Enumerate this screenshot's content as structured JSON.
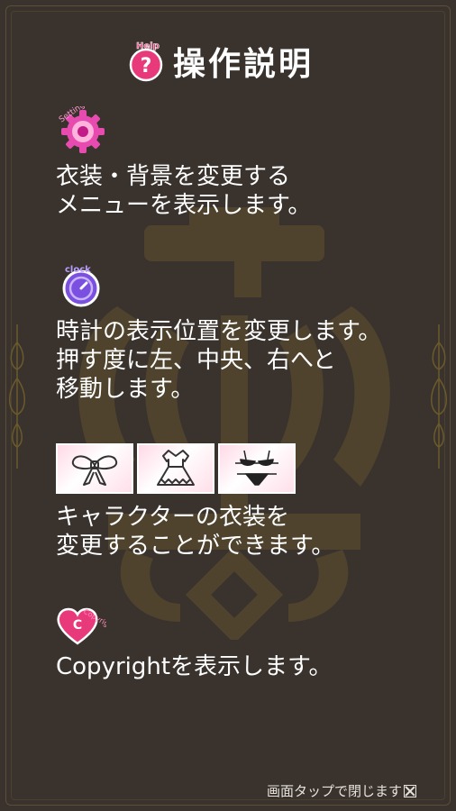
{
  "header": {
    "help_badge": "Help",
    "help_glyph": "?",
    "title": "操作説明"
  },
  "sections": [
    {
      "icon": "setting-gear-icon",
      "icon_label": "Setting",
      "lines": [
        "衣装・背景を変更する",
        "メニューを表示します。"
      ]
    },
    {
      "icon": "clock-icon",
      "icon_label": "clock",
      "lines": [
        "時計の表示位置を変更します。",
        "押す度に左、中央、右へと",
        "移動します。"
      ]
    },
    {
      "icon": "outfit-buttons",
      "outfits": [
        "ribbon",
        "dress",
        "bikini"
      ],
      "lines": [
        "キャラクターの衣装を",
        "変更することができます。"
      ]
    },
    {
      "icon": "copyright-heart-icon",
      "icon_label": "Copyright",
      "icon_glyph": "C",
      "lines": [
        "Copyrightを表示します。"
      ]
    }
  ],
  "footer": {
    "hint": "画面タップで閉じます"
  },
  "colors": {
    "background": "#3a332d",
    "accent_pink": "#e8397a",
    "accent_purple": "#7b4fe0",
    "watermark_gold": "#6a5a2c"
  }
}
